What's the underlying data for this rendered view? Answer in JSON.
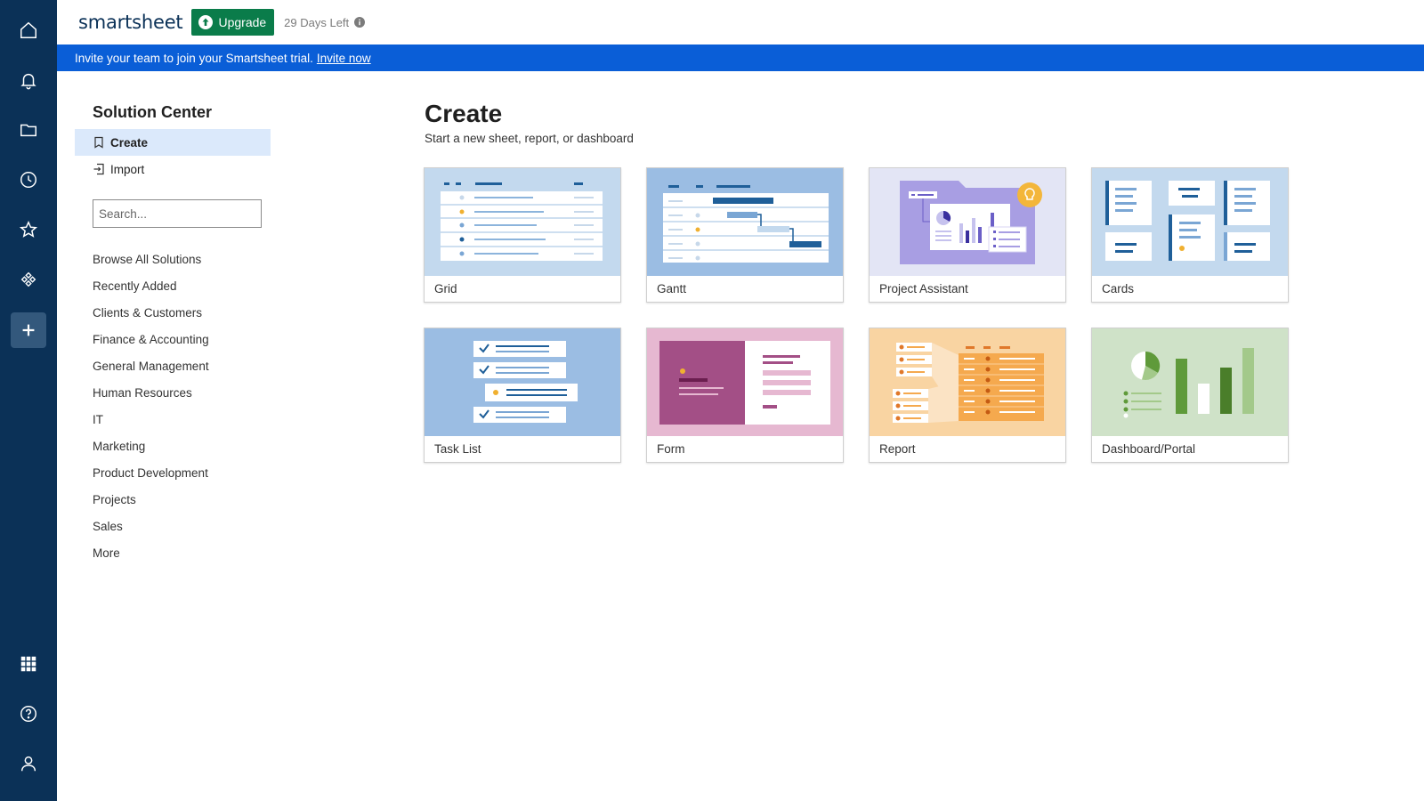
{
  "header": {
    "logo": "smartsheet",
    "upgrade_label": "Upgrade",
    "trial_days": "29 Days Left"
  },
  "banner": {
    "text": "Invite your team to join your Smartsheet trial.",
    "link": "Invite now"
  },
  "rail": {
    "icons": [
      "home-icon",
      "bell-icon",
      "folder-icon",
      "clock-icon",
      "star-icon",
      "workapps-icon",
      "plus-icon",
      "grid-apps-icon",
      "help-icon",
      "user-icon"
    ]
  },
  "subnav": {
    "title": "Solution Center",
    "create": "Create",
    "import": "Import",
    "search_placeholder": "Search...",
    "categories": [
      "Browse All Solutions",
      "Recently Added",
      "Clients & Customers",
      "Finance & Accounting",
      "General Management",
      "Human Resources",
      "IT",
      "Marketing",
      "Product Development",
      "Projects",
      "Sales",
      "More"
    ]
  },
  "main": {
    "title": "Create",
    "subtitle": "Start a new sheet, report, or dashboard",
    "cards": [
      "Grid",
      "Gantt",
      "Project Assistant",
      "Cards",
      "Task List",
      "Form",
      "Report",
      "Dashboard/Portal"
    ]
  },
  "colors": {
    "rail": "#0b3157",
    "banner": "#0a5ed7",
    "upgrade": "#0a7c4a",
    "active_nav": "#dbe9fb"
  }
}
